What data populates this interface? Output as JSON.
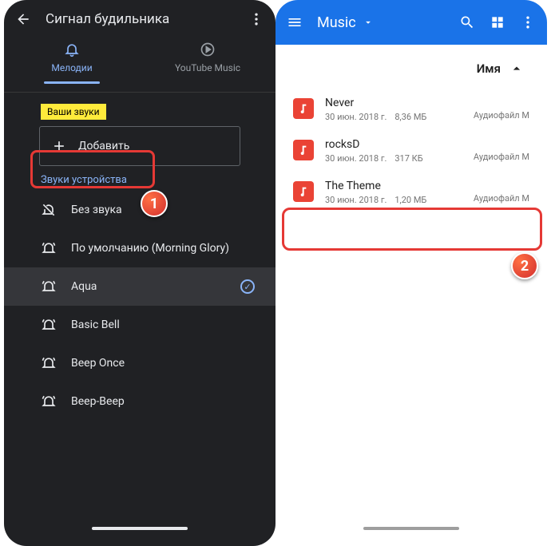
{
  "left": {
    "title": "Сигнал будильника",
    "tabs": {
      "melodies": "Мелодии",
      "youtube": "YouTube Music"
    },
    "yourSounds": "Ваши звуки",
    "addLabel": "Добавить",
    "deviceSoundsLabel": "Звуки устройства",
    "items": [
      {
        "label": "Без звука",
        "muted": true,
        "selected": false
      },
      {
        "label": "По умолчанию (Morning Glory)",
        "selected": false
      },
      {
        "label": "Aqua",
        "selected": true
      },
      {
        "label": "Basic Bell",
        "selected": false
      },
      {
        "label": "Beep Once",
        "selected": false
      },
      {
        "label": "Beep-Beep",
        "selected": false
      }
    ]
  },
  "right": {
    "title": "Music",
    "sortLabel": "Имя",
    "files": [
      {
        "name": "Never",
        "date": "30 июн. 2018 г.",
        "size": "8,36 МБ",
        "type": "Аудиофайл M"
      },
      {
        "name": "rocksD",
        "date": "30 июн. 2018 г.",
        "size": "317 КБ",
        "type": "Аудиофайл M"
      },
      {
        "name": "The Theme",
        "date": "30 июн. 2018 г.",
        "size": "1,20 МБ",
        "type": "Аудиофайл M"
      }
    ]
  },
  "badges": {
    "one": "1",
    "two": "2"
  }
}
